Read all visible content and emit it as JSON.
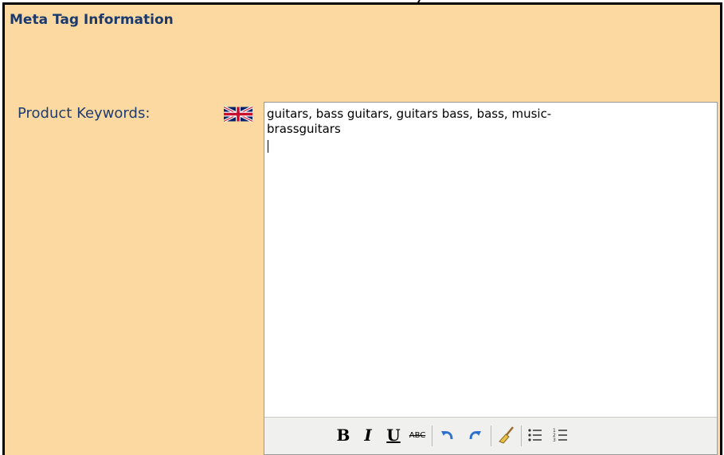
{
  "section": {
    "title": "Meta Tag Information"
  },
  "field": {
    "label": "Product Keywords:",
    "value": "guitars, bass guitars, guitars bass, bass, music-brassguitars"
  },
  "language_flag": "uk-flag-icon",
  "toolbar": {
    "bold": "B",
    "italic": "I",
    "underline": "U",
    "strikethrough": "ABC"
  },
  "colors": {
    "panel_bg": "#fcd9a0",
    "title_color": "#1b3a6b",
    "label_color": "#1e3c6e"
  }
}
